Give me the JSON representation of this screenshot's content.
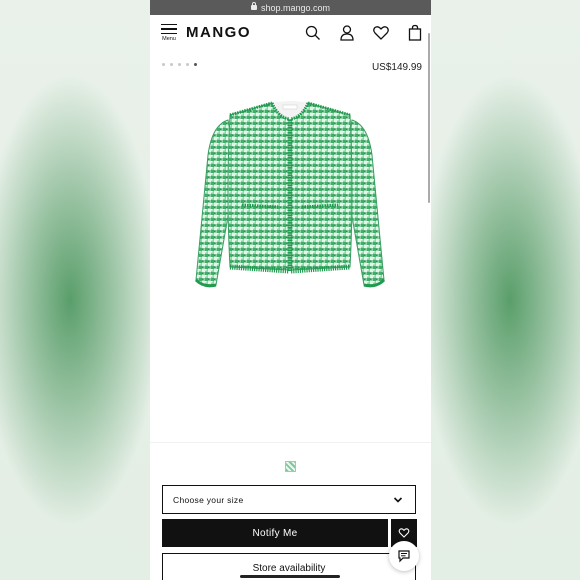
{
  "browser": {
    "url": "shop.mango.com"
  },
  "header": {
    "menu_label": "Menu",
    "logo": "MANGO"
  },
  "icons": [
    "search-icon",
    "user-icon",
    "heart-icon",
    "shopping-bag-icon",
    "chevron-down-icon",
    "chat-icon",
    "lock-icon"
  ],
  "product": {
    "price": "US$149.99",
    "gallery_index": 5,
    "gallery_total": 5
  },
  "purchase": {
    "size_placeholder": "Choose your size",
    "notify_label": "Notify Me",
    "store_label": "Store availability"
  },
  "colors": {
    "accent": "#111111",
    "jacket_green": "#2fa65a",
    "url_bar": "#5a5a5a"
  }
}
